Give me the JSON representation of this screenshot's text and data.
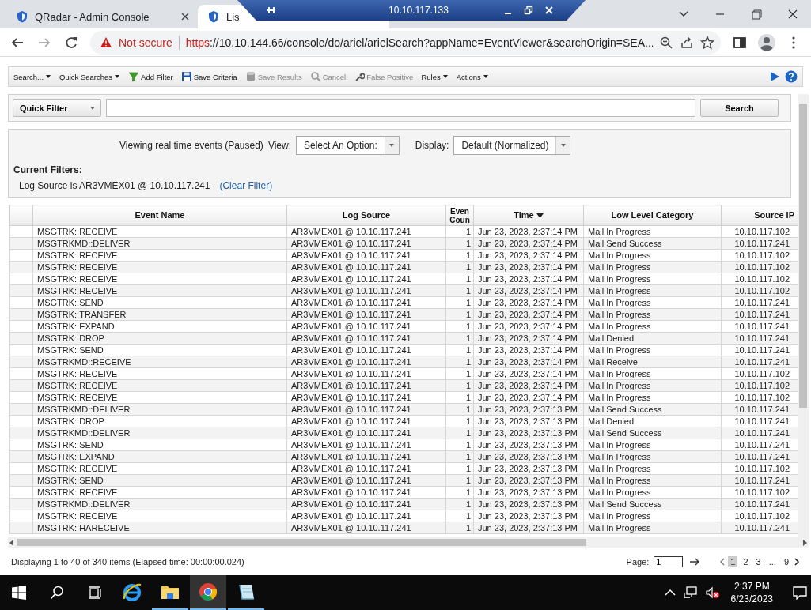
{
  "browser": {
    "tabs": [
      {
        "title": "QRadar - Admin Console",
        "selected": false,
        "covered": false
      },
      {
        "title": "Lis",
        "selected": true,
        "covered": true
      }
    ],
    "rdp_bar": {
      "title": "10.10.117.133"
    },
    "address_bar": {
      "security": "Not secure",
      "scheme": "https",
      "url_rest": "://10.10.144.66/console/do/ariel/arielSearch?appName=EventViewer&searchOrigin=SEA..."
    }
  },
  "toolbar": {
    "items": [
      {
        "label": "Search...",
        "kind": "menu",
        "disabled": false
      },
      {
        "label": "Quick Searches",
        "kind": "menu",
        "disabled": false
      },
      {
        "label": "Add Filter",
        "kind": "filter",
        "disabled": false
      },
      {
        "label": "Save Criteria",
        "kind": "save",
        "disabled": false
      },
      {
        "label": "Save Results",
        "kind": "database",
        "disabled": true
      },
      {
        "label": "Cancel",
        "kind": "cancel",
        "disabled": true
      },
      {
        "label": "False Positive",
        "kind": "wrench",
        "disabled": true
      },
      {
        "label": "Rules",
        "kind": "menu",
        "disabled": false
      },
      {
        "label": "Actions",
        "kind": "menu",
        "disabled": false
      }
    ]
  },
  "quick_filter": {
    "dropdown": "Quick Filter",
    "search_button": "Search"
  },
  "status_panel": {
    "message": "Viewing real time events (Paused)",
    "view_label": "View:",
    "view_value": "Select An Option:",
    "display_label": "Display:",
    "display_value": "Default (Normalized)",
    "filters_heading": "Current Filters:",
    "filters": [
      {
        "text": "Log Source is AR3VMEX01 @ 10.10.117.241",
        "clear_link": "(Clear Filter)"
      }
    ]
  },
  "table": {
    "columns": [
      {
        "label": "Event Name",
        "sorted": false
      },
      {
        "label": "Log Source",
        "sorted": false
      },
      {
        "label": "Even Coun",
        "sorted": false
      },
      {
        "label": "Time",
        "sorted": true
      },
      {
        "label": "Low Level Category",
        "sorted": false
      },
      {
        "label": "Source IP",
        "sorted": false
      }
    ],
    "rows": [
      [
        "MSGTRK::RECEIVE",
        "AR3VMEX01 @ 10.10.117.241",
        "1",
        "Jun 23, 2023, 2:37:14 PM",
        "Mail In Progress",
        "10.10.117.102"
      ],
      [
        "MSGTRKMD::DELIVER",
        "AR3VMEX01 @ 10.10.117.241",
        "1",
        "Jun 23, 2023, 2:37:14 PM",
        "Mail Send Success",
        "10.10.117.241"
      ],
      [
        "MSGTRK::RECEIVE",
        "AR3VMEX01 @ 10.10.117.241",
        "1",
        "Jun 23, 2023, 2:37:14 PM",
        "Mail In Progress",
        "10.10.117.102"
      ],
      [
        "MSGTRK::RECEIVE",
        "AR3VMEX01 @ 10.10.117.241",
        "1",
        "Jun 23, 2023, 2:37:14 PM",
        "Mail In Progress",
        "10.10.117.102"
      ],
      [
        "MSGTRK::RECEIVE",
        "AR3VMEX01 @ 10.10.117.241",
        "1",
        "Jun 23, 2023, 2:37:14 PM",
        "Mail In Progress",
        "10.10.117.102"
      ],
      [
        "MSGTRK::RECEIVE",
        "AR3VMEX01 @ 10.10.117.241",
        "1",
        "Jun 23, 2023, 2:37:14 PM",
        "Mail In Progress",
        "10.10.117.102"
      ],
      [
        "MSGTRK::SEND",
        "AR3VMEX01 @ 10.10.117.241",
        "1",
        "Jun 23, 2023, 2:37:14 PM",
        "Mail In Progress",
        "10.10.117.241"
      ],
      [
        "MSGTRK::TRANSFER",
        "AR3VMEX01 @ 10.10.117.241",
        "1",
        "Jun 23, 2023, 2:37:14 PM",
        "Mail In Progress",
        "10.10.117.241"
      ],
      [
        "MSGTRK::EXPAND",
        "AR3VMEX01 @ 10.10.117.241",
        "1",
        "Jun 23, 2023, 2:37:14 PM",
        "Mail In Progress",
        "10.10.117.241"
      ],
      [
        "MSGTRK::DROP",
        "AR3VMEX01 @ 10.10.117.241",
        "1",
        "Jun 23, 2023, 2:37:14 PM",
        "Mail Denied",
        "10.10.117.241"
      ],
      [
        "MSGTRK::SEND",
        "AR3VMEX01 @ 10.10.117.241",
        "1",
        "Jun 23, 2023, 2:37:14 PM",
        "Mail In Progress",
        "10.10.117.241"
      ],
      [
        "MSGTRKMD::RECEIVE",
        "AR3VMEX01 @ 10.10.117.241",
        "1",
        "Jun 23, 2023, 2:37:14 PM",
        "Mail Receive",
        "10.10.117.241"
      ],
      [
        "MSGTRK::RECEIVE",
        "AR3VMEX01 @ 10.10.117.241",
        "1",
        "Jun 23, 2023, 2:37:14 PM",
        "Mail In Progress",
        "10.10.117.102"
      ],
      [
        "MSGTRK::RECEIVE",
        "AR3VMEX01 @ 10.10.117.241",
        "1",
        "Jun 23, 2023, 2:37:14 PM",
        "Mail In Progress",
        "10.10.117.102"
      ],
      [
        "MSGTRK::RECEIVE",
        "AR3VMEX01 @ 10.10.117.241",
        "1",
        "Jun 23, 2023, 2:37:14 PM",
        "Mail In Progress",
        "10.10.117.102"
      ],
      [
        "MSGTRKMD::DELIVER",
        "AR3VMEX01 @ 10.10.117.241",
        "1",
        "Jun 23, 2023, 2:37:13 PM",
        "Mail Send Success",
        "10.10.117.241"
      ],
      [
        "MSGTRK::DROP",
        "AR3VMEX01 @ 10.10.117.241",
        "1",
        "Jun 23, 2023, 2:37:13 PM",
        "Mail Denied",
        "10.10.117.241"
      ],
      [
        "MSGTRKMD::DELIVER",
        "AR3VMEX01 @ 10.10.117.241",
        "1",
        "Jun 23, 2023, 2:37:13 PM",
        "Mail Send Success",
        "10.10.117.241"
      ],
      [
        "MSGTRK::SEND",
        "AR3VMEX01 @ 10.10.117.241",
        "1",
        "Jun 23, 2023, 2:37:13 PM",
        "Mail In Progress",
        "10.10.117.241"
      ],
      [
        "MSGTRK::EXPAND",
        "AR3VMEX01 @ 10.10.117.241",
        "1",
        "Jun 23, 2023, 2:37:13 PM",
        "Mail In Progress",
        "10.10.117.241"
      ],
      [
        "MSGTRK::RECEIVE",
        "AR3VMEX01 @ 10.10.117.241",
        "1",
        "Jun 23, 2023, 2:37:13 PM",
        "Mail In Progress",
        "10.10.117.102"
      ],
      [
        "MSGTRK::SEND",
        "AR3VMEX01 @ 10.10.117.241",
        "1",
        "Jun 23, 2023, 2:37:13 PM",
        "Mail In Progress",
        "10.10.117.241"
      ],
      [
        "MSGTRK::RECEIVE",
        "AR3VMEX01 @ 10.10.117.241",
        "1",
        "Jun 23, 2023, 2:37:13 PM",
        "Mail In Progress",
        "10.10.117.102"
      ],
      [
        "MSGTRKMD::DELIVER",
        "AR3VMEX01 @ 10.10.117.241",
        "1",
        "Jun 23, 2023, 2:37:13 PM",
        "Mail Send Success",
        "10.10.117.241"
      ],
      [
        "MSGTRK::RECEIVE",
        "AR3VMEX01 @ 10.10.117.241",
        "1",
        "Jun 23, 2023, 2:37:13 PM",
        "Mail In Progress",
        "10.10.117.102"
      ],
      [
        "MSGTRK::HARECEIVE",
        "AR3VMEX01 @ 10.10.117.241",
        "1",
        "Jun 23, 2023, 2:37:13 PM",
        "Mail In Progress",
        "10.10.117.241"
      ]
    ]
  },
  "footer": {
    "summary": "Displaying 1 to 40 of 340 items (Elapsed time: 00:00:00.024)",
    "page_label": "Page:",
    "page_value": "1",
    "pages": [
      {
        "label": "1",
        "selected": true
      },
      {
        "label": "2",
        "selected": false
      },
      {
        "label": "3",
        "selected": false
      },
      {
        "label": "...",
        "selected": false
      },
      {
        "label": "9",
        "selected": false
      }
    ]
  },
  "taskbar": {
    "apps": [
      {
        "kind": "ie",
        "running": false,
        "selected": false
      },
      {
        "kind": "folder",
        "running": true,
        "selected": false
      },
      {
        "kind": "chrome",
        "running": true,
        "selected": true
      },
      {
        "kind": "notepad",
        "running": true,
        "selected": false
      }
    ],
    "time": "2:37 PM",
    "date": "6/23/2023"
  }
}
